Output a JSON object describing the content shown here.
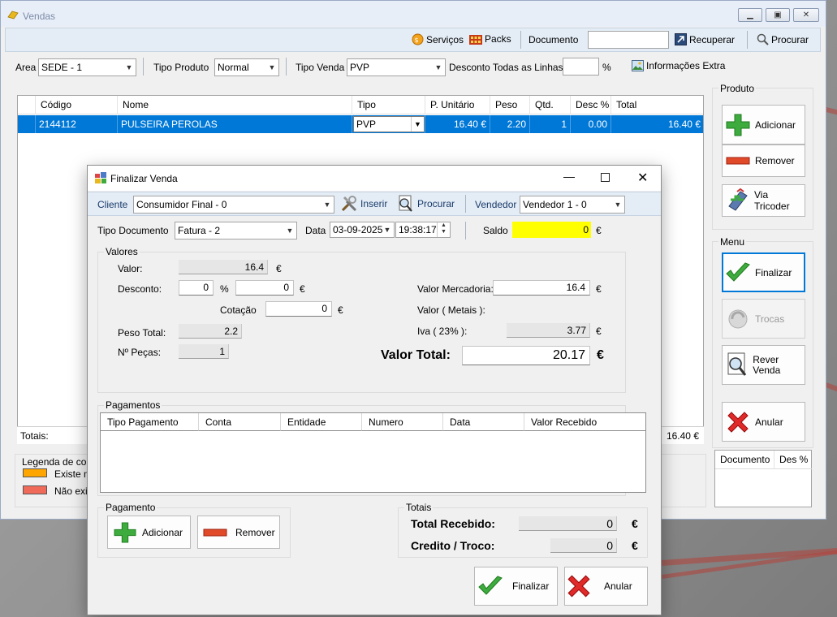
{
  "main_window": {
    "title": "Vendas",
    "toolbar": {
      "servicos": "Serviços",
      "packs": "Packs",
      "documento_label": "Documento",
      "documento_value": "",
      "recuperar": "Recuperar",
      "procurar": "Procurar"
    },
    "filters": {
      "area_label": "Area",
      "area_value": "SEDE - 1",
      "tipo_produto_label": "Tipo Produto",
      "tipo_produto_value": "Normal",
      "tipo_venda_label": "Tipo Venda",
      "tipo_venda_value": "PVP",
      "desconto_label": "Desconto Todas as Linhas",
      "desconto_value": "",
      "percent": "%",
      "info_extra": "Informações Extra"
    },
    "grid": {
      "columns": [
        "Código",
        "Nome",
        "Tipo",
        "P. Unitário",
        "Peso",
        "Qtd.",
        "Desc %",
        "Total"
      ],
      "rows": [
        {
          "codigo": "2144112",
          "nome": "PULSEIRA PEROLAS",
          "tipo": "PVP",
          "p_unitario": "16.40 €",
          "peso": "2.20",
          "qtd": "1",
          "desc": "0.00",
          "total": "16.40 €"
        }
      ],
      "totals_label": "Totais:",
      "totals_value": "16.40 €"
    },
    "legend": {
      "title": "Legenda de core",
      "items": [
        {
          "label": "Existe ma",
          "color": "#ffa500"
        },
        {
          "label": "Não exis",
          "color": "#f06a5a"
        }
      ]
    },
    "produto_group": {
      "title": "Produto",
      "adicionar": "Adicionar",
      "remover": "Remover",
      "via_tricoder": "Via Tricoder"
    },
    "menu_group": {
      "title": "Menu",
      "finalizar": "Finalizar",
      "trocas": "Trocas",
      "rever_venda": "Rever Venda",
      "anular": "Anular"
    },
    "doc_grid": {
      "columns": [
        "Documento",
        "Des %"
      ]
    }
  },
  "dialog": {
    "title": "Finalizar Venda",
    "cliente_label": "Cliente",
    "cliente_value": "Consumidor Final - 0",
    "inserir": "Inserir",
    "procurar": "Procurar",
    "vendedor_label": "Vendedor",
    "vendedor_value": "Vendedor 1 - 0",
    "tipo_documento_label": "Tipo Documento",
    "tipo_documento_value": "Fatura - 2",
    "data_label": "Data",
    "data_value": "03-09-2025",
    "hora_value": "19:38:17",
    "saldo_label": "Saldo",
    "saldo_value": "0",
    "currency": "€",
    "valores": {
      "title": "Valores",
      "valor_label": "Valor:",
      "valor_value": "16.4",
      "desconto_label": "Desconto:",
      "desconto_pct": "0",
      "pct": "%",
      "desconto_value": "0",
      "cotacao_label": "Cotação",
      "cotacao_value": "0",
      "peso_total_label": "Peso Total:",
      "peso_total_value": "2.2",
      "n_pecas_label": "Nº Peças:",
      "n_pecas_value": "1",
      "valor_mercadoria_label": "Valor Mercadoria:",
      "valor_mercadoria_value": "16.4",
      "valor_metais_label": "Valor ( Metais ):",
      "iva_label": "Iva ( 23% ):",
      "iva_value": "3.77",
      "valor_total_label": "Valor Total:",
      "valor_total_value": "20.17"
    },
    "pagamentos": {
      "title": "Pagamentos",
      "columns": [
        "Tipo Pagamento",
        "Conta",
        "Entidade",
        "Numero",
        "Data",
        "Valor Recebido"
      ]
    },
    "pagamento": {
      "title": "Pagamento",
      "adicionar": "Adicionar",
      "remover": "Remover"
    },
    "totais": {
      "title": "Totais",
      "total_recebido_label": "Total Recebido:",
      "total_recebido_value": "0",
      "credito_troco_label": "Credito / Troco:",
      "credito_troco_value": "0"
    },
    "finalizar": "Finalizar",
    "anular": "Anular"
  }
}
